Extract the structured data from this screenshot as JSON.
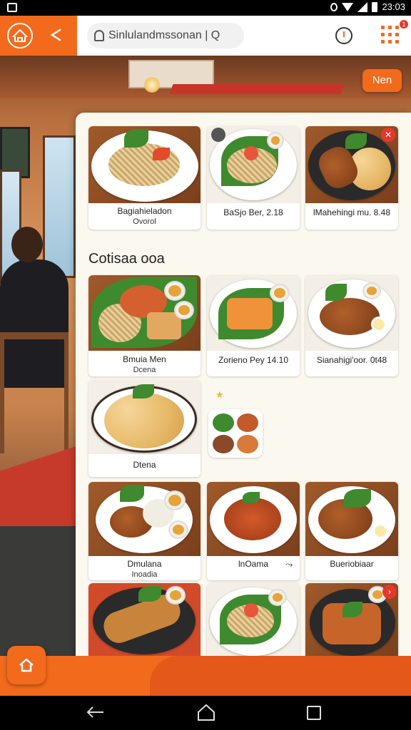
{
  "status_bar": {
    "time": "23:03"
  },
  "app_bar": {
    "search_text": "Sinlulandmssonan | Q",
    "notification_count": "1"
  },
  "overlay_button_label": "Nen",
  "section_title": "Cotisaa ooa",
  "cards": [
    {
      "title": "Bagiahieladon",
      "subtitle": "Ovorol"
    },
    {
      "title": "BaSjo Ber, 2.18",
      "subtitle": ""
    },
    {
      "title": "lMahehingi mu. 8.48",
      "subtitle": ""
    },
    {
      "title": "Bmuia Men",
      "subtitle": "Dcena"
    },
    {
      "title": "Zorieno Pey 14.10",
      "subtitle": ""
    },
    {
      "title": "Sianahigi'oor. 0t48",
      "subtitle": ""
    },
    {
      "title": "Dtena",
      "subtitle": ""
    },
    {
      "title": "Dmulana",
      "subtitle": "Inoadia"
    },
    {
      "title": "lnOama",
      "subtitle": ""
    },
    {
      "title": "Bueriobiaar",
      "subtitle": ""
    }
  ],
  "colors": {
    "brand": "#f26b1d",
    "panel": "#fbf8ef",
    "badge": "#e5382a"
  },
  "icons": [
    "logo-icon",
    "share-icon",
    "bell-icon",
    "clock-icon",
    "grid-icon",
    "home-icon",
    "back-icon",
    "nav-home-icon",
    "recent-apps-icon"
  ]
}
